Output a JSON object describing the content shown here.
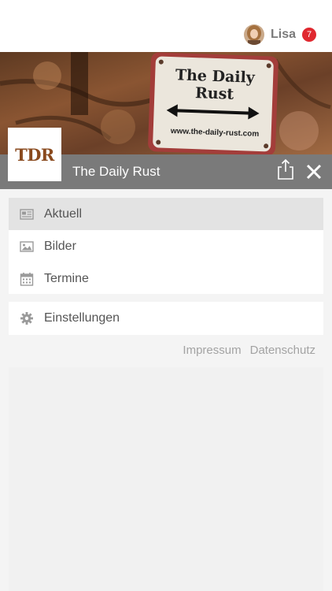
{
  "user": {
    "name": "Lisa",
    "notification_count": "7",
    "avatar_icon": "user-avatar"
  },
  "banner": {
    "sign_title": "The Daily Rust",
    "sign_url": "www.the-daily-rust.com"
  },
  "header": {
    "logo_text": "TDR",
    "title": "The Daily Rust",
    "share_icon": "share-icon",
    "close_icon": "close-icon"
  },
  "menu": {
    "primary_items": [
      {
        "label": "Aktuell",
        "icon": "newspaper-icon",
        "active": true
      },
      {
        "label": "Bilder",
        "icon": "image-icon",
        "active": false
      },
      {
        "label": "Termine",
        "icon": "calendar-icon",
        "active": false
      }
    ],
    "secondary_items": [
      {
        "label": "Einstellungen",
        "icon": "gear-icon",
        "active": false
      }
    ]
  },
  "footer": {
    "impressum": "Impressum",
    "datenschutz": "Datenschutz"
  },
  "colors": {
    "accent_badge": "#e0282f",
    "title_bar": "#7a7a7a",
    "active_item": "#e3e3e3"
  }
}
